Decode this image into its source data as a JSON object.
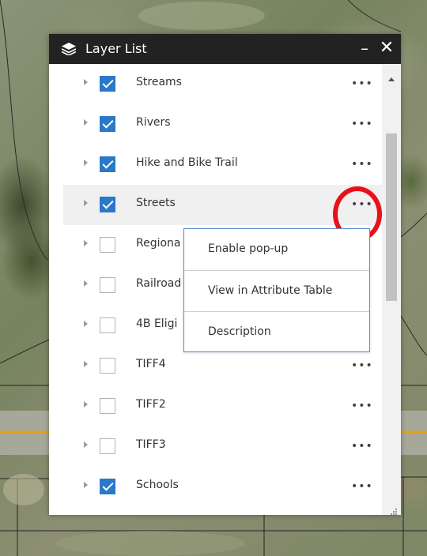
{
  "panel": {
    "title": "Layer List",
    "minimize_label": "–",
    "close_label": "✕"
  },
  "layers": [
    {
      "label": "Streams",
      "checked": true
    },
    {
      "label": "Rivers",
      "checked": true
    },
    {
      "label": "Hike and Bike Trail",
      "checked": true
    },
    {
      "label": "Streets",
      "checked": true
    },
    {
      "label": "Regiona",
      "checked": false
    },
    {
      "label": "Railroad",
      "checked": false
    },
    {
      "label": "4B Eligi",
      "checked": false
    },
    {
      "label": "TIFF4",
      "checked": false
    },
    {
      "label": "TIFF2",
      "checked": false
    },
    {
      "label": "TIFF3",
      "checked": false
    },
    {
      "label": "Schools",
      "checked": true
    }
  ],
  "more_options_glyph": "•••",
  "context_menu": {
    "items": [
      {
        "label": "Enable pop-up"
      },
      {
        "label": "View in Attribute Table"
      },
      {
        "label": "Description"
      }
    ]
  },
  "colors": {
    "titlebar": "#222222",
    "checkbox_checked": "#2a78c8",
    "annotation_circle": "#e8101a",
    "menu_border": "#5a8fd0",
    "road": "#e3a51b"
  },
  "icons": [
    "layers-icon",
    "minimize-icon",
    "close-icon",
    "expand-chevron-icon",
    "more-options-icon",
    "scroll-up-icon",
    "resize-corner-icon"
  ]
}
